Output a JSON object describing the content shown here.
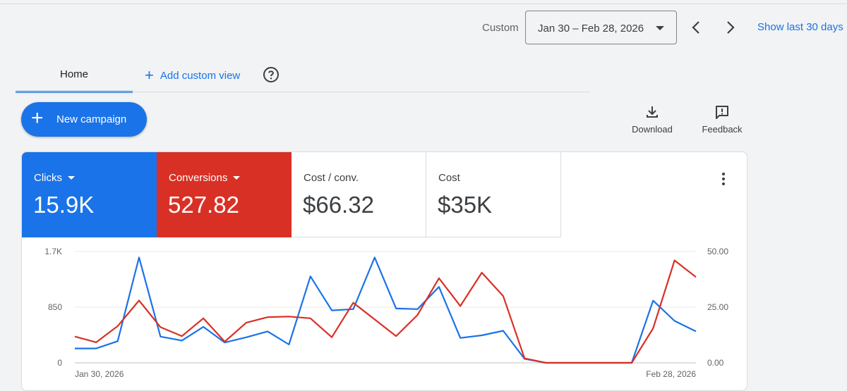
{
  "date_range": {
    "custom_label": "Custom",
    "value": "Jan 30 – Feb 28, 2026",
    "show_last": "Show last 30 days"
  },
  "tabs": {
    "home": "Home",
    "add_custom_view": "Add custom view"
  },
  "actions": {
    "new_campaign": "New campaign",
    "download": "Download",
    "feedback": "Feedback"
  },
  "metrics": {
    "clicks": {
      "label": "Clicks",
      "value": "15.9K",
      "color": "#1a73e8"
    },
    "conversions": {
      "label": "Conversions",
      "value": "527.82",
      "color": "#d93025"
    },
    "cost_per_conv": {
      "label": "Cost / conv.",
      "value": "$66.32"
    },
    "cost": {
      "label": "Cost",
      "value": "$35K"
    }
  },
  "chart_data": {
    "type": "line",
    "x_start_label": "Jan 30, 2026",
    "x_end_label": "Feb 28, 2026",
    "y_left_ticks": [
      "0",
      "850",
      "1.7K"
    ],
    "y_left_max": 1700,
    "y_right_ticks": [
      "0.00",
      "25.00",
      "50.00"
    ],
    "y_right_max": 50,
    "grid": true,
    "series": [
      {
        "name": "Clicks",
        "axis": "left",
        "color": "#1a73e8",
        "values": [
          220,
          220,
          330,
          1610,
          400,
          340,
          550,
          310,
          390,
          480,
          280,
          1320,
          800,
          820,
          1610,
          830,
          820,
          1160,
          380,
          420,
          490,
          60,
          0,
          0,
          0,
          0,
          0,
          950,
          640,
          480
        ]
      },
      {
        "name": "Conversions",
        "axis": "right",
        "color": "#d93025",
        "values": [
          11.8,
          9.2,
          16.5,
          28,
          16,
          12,
          20,
          9.5,
          18,
          20.5,
          20.8,
          20,
          11.5,
          27,
          19.5,
          12,
          21.5,
          38,
          25.5,
          40.5,
          30,
          2,
          0,
          0,
          0,
          0,
          0,
          15.5,
          46,
          38.5
        ]
      }
    ]
  }
}
